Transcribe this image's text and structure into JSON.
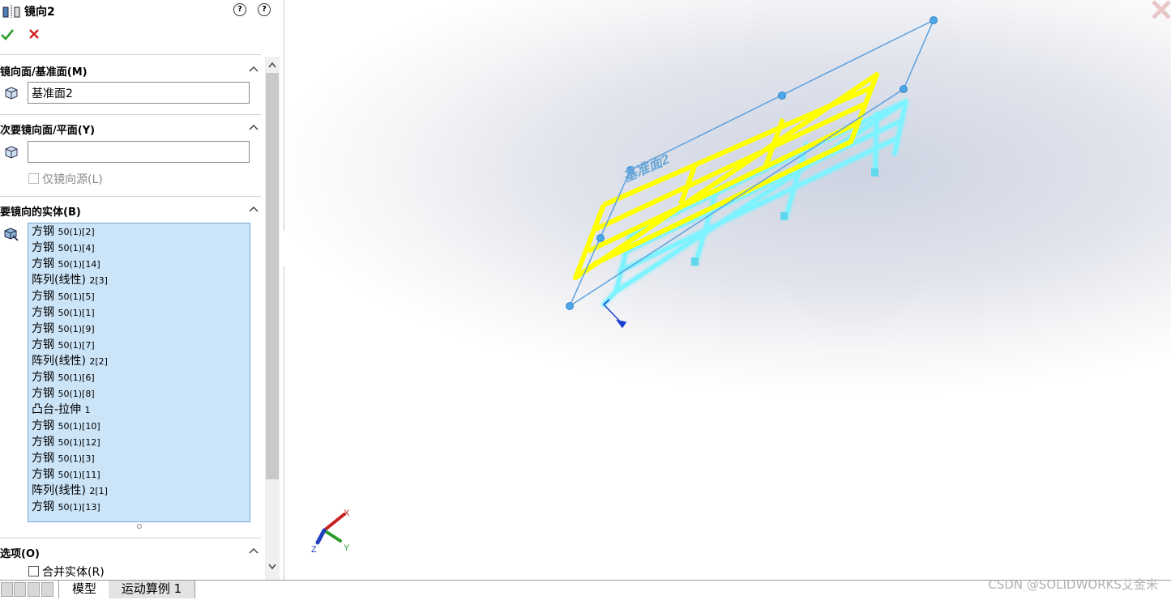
{
  "panel": {
    "title": "镜向2",
    "help_icons": [
      "help-star-icon",
      "help-icon"
    ],
    "ok_icon": "check-icon",
    "cancel_icon": "close-icon",
    "sections": {
      "mirror_face": {
        "title": "镜向面/基准面(M)",
        "value": "基准面2",
        "icon": "cube-icon"
      },
      "secondary_face": {
        "title": "次要镜向面/平面(Y)",
        "value": "",
        "icon": "cube-icon",
        "checkbox_label": "仅镜向源(L)",
        "checkbox_checked": false
      },
      "bodies": {
        "title": "要镜向的实体(B)",
        "icon": "body-icon",
        "items": [
          {
            "name": "方钢",
            "suffix": "50(1)[2]"
          },
          {
            "name": "方钢",
            "suffix": "50(1)[4]"
          },
          {
            "name": "方钢",
            "suffix": "50(1)[14]"
          },
          {
            "name": "阵列(线性)",
            "suffix": "2[3]"
          },
          {
            "name": "方钢",
            "suffix": "50(1)[5]"
          },
          {
            "name": "方钢",
            "suffix": "50(1)[1]"
          },
          {
            "name": "方钢",
            "suffix": "50(1)[9]"
          },
          {
            "name": "方钢",
            "suffix": "50(1)[7]"
          },
          {
            "name": "阵列(线性)",
            "suffix": "2[2]"
          },
          {
            "name": "方钢",
            "suffix": "50(1)[6]"
          },
          {
            "name": "方钢",
            "suffix": "50(1)[8]"
          },
          {
            "name": "凸台-拉伸",
            "suffix": "1"
          },
          {
            "name": "方钢",
            "suffix": "50(1)[10]"
          },
          {
            "name": "方钢",
            "suffix": "50(1)[12]"
          },
          {
            "name": "方钢",
            "suffix": "50(1)[3]"
          },
          {
            "name": "方钢",
            "suffix": "50(1)[11]"
          },
          {
            "name": "阵列(线性)",
            "suffix": "2[1]"
          },
          {
            "name": "方钢",
            "suffix": "50(1)[13]"
          }
        ]
      },
      "options": {
        "title": "选项(O)",
        "checkbox_label": "合并实体(R)",
        "checkbox_checked": false
      }
    }
  },
  "viewport": {
    "plane_label": "基准面2",
    "triad": {
      "x": "X",
      "y": "Y",
      "z": "Z"
    },
    "colors": {
      "source": "#ffff00",
      "mirror": "#7df3ff",
      "plane": "#5aa0e0"
    }
  },
  "tabs": [
    {
      "label": "模型",
      "active": true
    },
    {
      "label": "运动算例 1",
      "active": false
    }
  ],
  "watermark": "CSDN @SOLIDWORKS艾金米"
}
